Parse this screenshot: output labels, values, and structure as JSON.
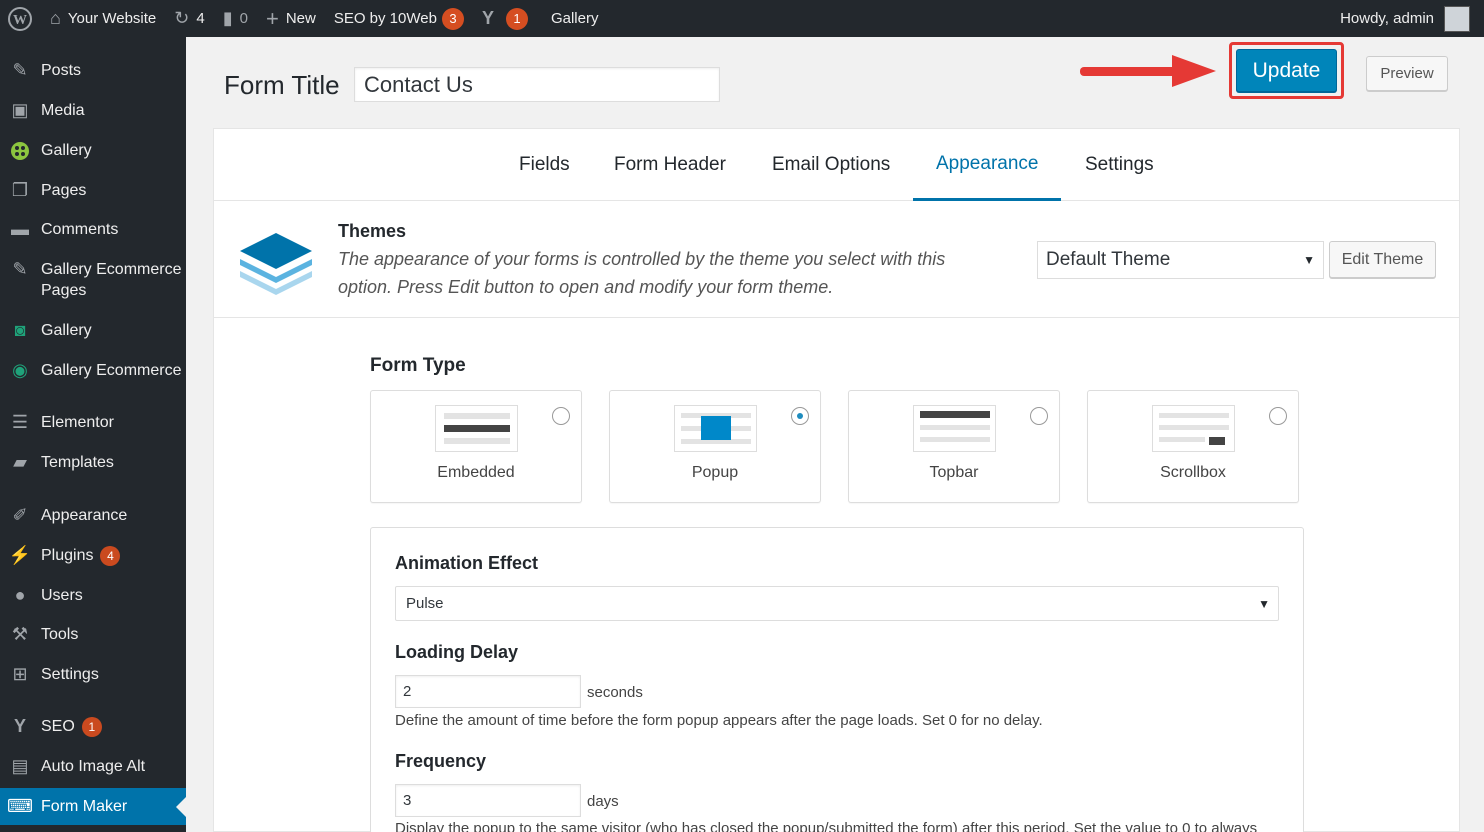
{
  "admin_bar": {
    "site_name": "Your Website",
    "updates_count": "4",
    "comments_count": "0",
    "new_label": "New",
    "seo_label": "SEO by 10Web",
    "seo_badge": "3",
    "yoast_badge": "1",
    "gallery_label": "Gallery",
    "greeting": "Howdy, admin"
  },
  "sidebar": {
    "items": [
      {
        "label": "Posts",
        "icon": "pin-icon"
      },
      {
        "label": "Media",
        "icon": "media-icon"
      },
      {
        "label": "Gallery",
        "icon": "gallery-icon"
      },
      {
        "label": "Pages",
        "icon": "pages-icon"
      },
      {
        "label": "Comments",
        "icon": "comment-icon"
      },
      {
        "label": "Gallery Ecommerce Pages",
        "icon": "pin-icon"
      },
      {
        "label": "Gallery",
        "icon": "camera-icon"
      },
      {
        "label": "Gallery Ecommerce",
        "icon": "eye-icon"
      },
      {
        "label": "Elementor",
        "icon": "elementor-icon"
      },
      {
        "label": "Templates",
        "icon": "folder-icon"
      },
      {
        "label": "Appearance",
        "icon": "brush-icon"
      },
      {
        "label": "Plugins",
        "icon": "plug-icon",
        "badge": "4"
      },
      {
        "label": "Users",
        "icon": "user-icon"
      },
      {
        "label": "Tools",
        "icon": "wrench-icon"
      },
      {
        "label": "Settings",
        "icon": "settings-icon"
      },
      {
        "label": "SEO",
        "icon": "yoast-icon",
        "badge": "1"
      },
      {
        "label": "Auto Image Alt",
        "icon": "image-icon"
      },
      {
        "label": "Form Maker",
        "icon": "form-icon"
      }
    ]
  },
  "header": {
    "form_title_label": "Form Title",
    "form_title_value": "Contact Us",
    "update_label": "Update",
    "preview_label": "Preview"
  },
  "tabs": [
    "Fields",
    "Form Header",
    "Email Options",
    "Appearance",
    "Settings"
  ],
  "active_tab": "Appearance",
  "themes": {
    "title": "Themes",
    "description": "The appearance of your forms is controlled by the theme you select with this option. Press Edit button to open and modify your form theme.",
    "selected_theme": "Default Theme",
    "edit_label": "Edit Theme"
  },
  "form_type": {
    "title": "Form Type",
    "options": [
      {
        "label": "Embedded",
        "selected": false
      },
      {
        "label": "Popup",
        "selected": true
      },
      {
        "label": "Topbar",
        "selected": false
      },
      {
        "label": "Scrollbox",
        "selected": false
      }
    ]
  },
  "popup_settings": {
    "animation_title": "Animation Effect",
    "animation_value": "Pulse",
    "loading_delay_title": "Loading Delay",
    "loading_delay_value": "2",
    "loading_delay_unit": "seconds",
    "loading_delay_help": "Define the amount of time before the form popup appears after the page loads. Set 0 for no delay.",
    "frequency_title": "Frequency",
    "frequency_value": "3",
    "frequency_unit": "days",
    "frequency_help": "Display the popup to the same visitor (who has closed the popup/submitted the form) after this period. Set the value to 0 to always"
  },
  "colors": {
    "accent": "#0073aa",
    "update_button": "#0085ba",
    "highlight": "#e53935",
    "badge": "#d54e21"
  }
}
